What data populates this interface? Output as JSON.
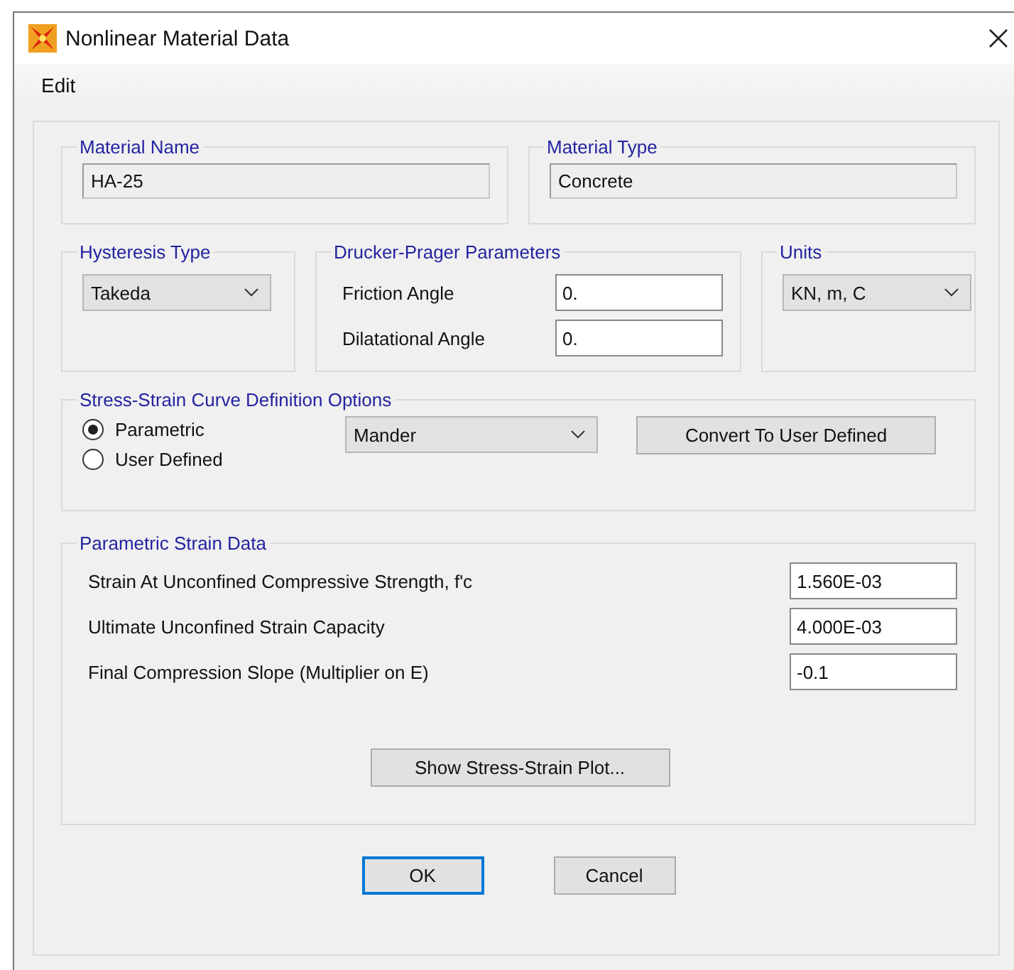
{
  "window": {
    "title": "Nonlinear Material Data"
  },
  "menu": [
    "Edit"
  ],
  "material_name": {
    "label": "Material Name",
    "value": "HA-25"
  },
  "material_type": {
    "label": "Material Type",
    "value": "Concrete"
  },
  "hysteresis": {
    "label": "Hysteresis Type",
    "value": "Takeda"
  },
  "drucker_prager": {
    "label": "Drucker-Prager Parameters",
    "fields": [
      {
        "label": "Friction Angle",
        "value": "0."
      },
      {
        "label": "Dilatational Angle",
        "value": "0."
      }
    ]
  },
  "units": {
    "label": "Units",
    "value": "KN, m, C"
  },
  "curve_options": {
    "label": "Stress-Strain Curve Definition Options",
    "options": [
      {
        "label": "Parametric",
        "selected": true
      },
      {
        "label": "User Defined",
        "selected": false
      }
    ],
    "curve_type": "Mander",
    "convert_button": "Convert To User Defined"
  },
  "parametric_strain": {
    "label": "Parametric Strain Data",
    "rows": [
      {
        "label": "Strain At Unconfined Compressive Strength, f'c",
        "value": "1.560E-03"
      },
      {
        "label": "Ultimate Unconfined Strain Capacity",
        "value": "4.000E-03"
      },
      {
        "label": "Final Compression Slope (Multiplier on E)",
        "value": "-0.1"
      }
    ],
    "plot_button": "Show Stress-Strain Plot..."
  },
  "buttons": [
    {
      "label": "OK",
      "default": true
    },
    {
      "label": "Cancel",
      "default": false
    }
  ]
}
